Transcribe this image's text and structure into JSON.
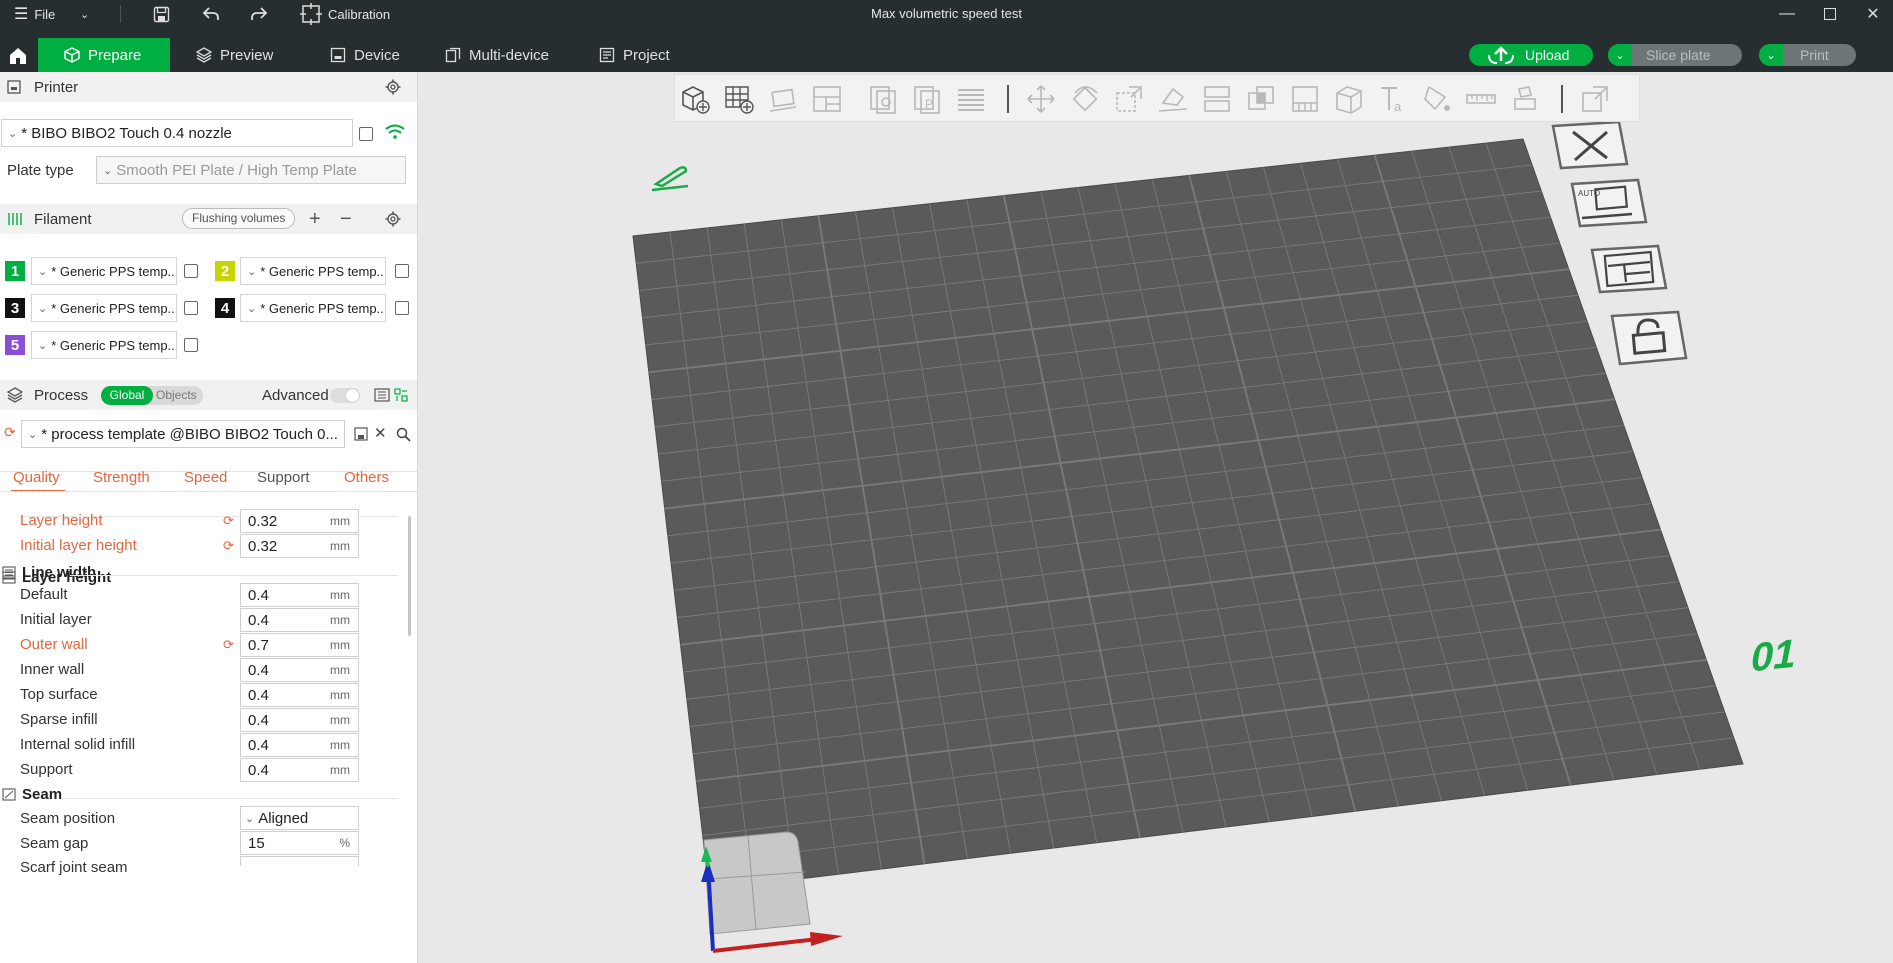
{
  "titlebar": {
    "file_label": "File",
    "calibration_label": "Calibration",
    "window_title": "Max volumetric speed test"
  },
  "menubar": {
    "tabs": [
      {
        "label": "Prepare",
        "active": true
      },
      {
        "label": "Preview"
      },
      {
        "label": "Device"
      },
      {
        "label": "Multi-device"
      },
      {
        "label": "Project"
      }
    ],
    "upload_label": "Upload",
    "slice_label": "Slice plate",
    "print_label": "Print"
  },
  "printer": {
    "section_label": "Printer",
    "selected": "* BIBO BIBO2 Touch 0.4 nozzle",
    "plate_type_label": "Plate type",
    "plate_type_value": "Smooth PEI Plate / High Temp Plate"
  },
  "filament": {
    "section_label": "Filament",
    "flushing_label": "Flushing volumes",
    "slots": [
      {
        "num": "1",
        "color": "#00ae42",
        "name": "* Generic PPS temp..."
      },
      {
        "num": "2",
        "color": "#c6d400",
        "name": "* Generic PPS temp..."
      },
      {
        "num": "3",
        "color": "#111111",
        "name": "* Generic PPS temp..."
      },
      {
        "num": "4",
        "color": "#111111",
        "name": "* Generic PPS temp..."
      },
      {
        "num": "5",
        "color": "#8a4fd8",
        "name": "* Generic PPS temp..."
      }
    ]
  },
  "process": {
    "section_label": "Process",
    "global_label": "Global",
    "objects_label": "Objects",
    "advanced_label": "Advanced",
    "preset": "* process template @BIBO BIBO2 Touch 0...",
    "tabs": [
      "Quality",
      "Strength",
      "Speed",
      "Support",
      "Others"
    ]
  },
  "quality": {
    "layer_height_group": "Layer height",
    "layer_height": {
      "label": "Layer height",
      "value": "0.32",
      "unit": "mm"
    },
    "initial_layer_height": {
      "label": "Initial layer height",
      "value": "0.32",
      "unit": "mm"
    },
    "line_width_group": "Line width",
    "line_widths": [
      {
        "label": "Default",
        "value": "0.4",
        "unit": "mm",
        "modified": false
      },
      {
        "label": "Initial layer",
        "value": "0.4",
        "unit": "mm",
        "modified": false
      },
      {
        "label": "Outer wall",
        "value": "0.7",
        "unit": "mm",
        "modified": true
      },
      {
        "label": "Inner wall",
        "value": "0.4",
        "unit": "mm",
        "modified": false
      },
      {
        "label": "Top surface",
        "value": "0.4",
        "unit": "mm",
        "modified": false
      },
      {
        "label": "Sparse infill",
        "value": "0.4",
        "unit": "mm",
        "modified": false
      },
      {
        "label": "Internal solid infill",
        "value": "0.4",
        "unit": "mm",
        "modified": false
      },
      {
        "label": "Support",
        "value": "0.4",
        "unit": "mm",
        "modified": false
      }
    ],
    "seam_group": "Seam",
    "seam_position": {
      "label": "Seam position",
      "value": "Aligned"
    },
    "seam_gap": {
      "label": "Seam gap",
      "value": "15",
      "unit": "%"
    },
    "scarf_joint_label": "Scarf joint seam"
  },
  "viewport": {
    "plate_number": "01"
  }
}
